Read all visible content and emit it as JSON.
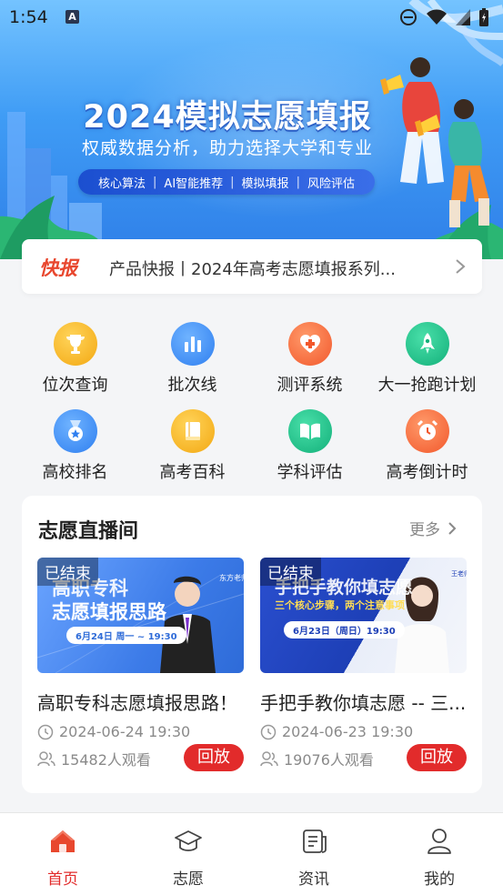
{
  "status_bar": {
    "time": "1:54",
    "notification_letter": "A"
  },
  "banner": {
    "title": "2024模拟志愿填报",
    "subtitle": "权威数据分析，助力选择大学和专业",
    "tags": [
      "核心算法",
      "AI智能推荐",
      "模拟填报",
      "风险评估"
    ]
  },
  "news": {
    "tag": "快报",
    "text": "产品快报丨2024年高考志愿填报系列..."
  },
  "grid": [
    {
      "label": "位次查询",
      "icon": "trophy-icon",
      "color": "#f6b61b"
    },
    {
      "label": "批次线",
      "icon": "bar-chart-icon",
      "color": "#3c8df3"
    },
    {
      "label": "测评系统",
      "icon": "heart-plus-icon",
      "color": "#f36b3b"
    },
    {
      "label": "大一抢跑计划",
      "icon": "rocket-icon",
      "color": "#1ec08a"
    },
    {
      "label": "高校排名",
      "icon": "medal-icon",
      "color": "#3c8df3"
    },
    {
      "label": "高考百科",
      "icon": "book-icon",
      "color": "#f6b61b"
    },
    {
      "label": "学科评估",
      "icon": "open-book-icon",
      "color": "#1ec08a"
    },
    {
      "label": "高考倒计时",
      "icon": "alarm-clock-icon",
      "color": "#f36b3b"
    }
  ],
  "live": {
    "title": "志愿直播间",
    "more": "更多",
    "items": [
      {
        "status": "已结束",
        "thumb_line1": "高职专科",
        "thumb_line2": "志愿填报思路",
        "thumb_date": "6月24日  周一 ~ 19:30",
        "title": "高职专科志愿填报思路！",
        "time": "2024-06-24 19:30",
        "viewers": "15482人观看",
        "action": "回放"
      },
      {
        "status": "已结束",
        "thumb_line1": "手把手教你填志愿",
        "thumb_line2": "三个核心步骤，两个注意事项",
        "thumb_date": "6月23日（周日）19:30",
        "title": "手把手教你填志愿 -- 三...",
        "time": "2024-06-23 19:30",
        "viewers": "19076人观看",
        "action": "回放"
      }
    ]
  },
  "nav": [
    {
      "label": "首页",
      "icon": "home-icon",
      "active": true
    },
    {
      "label": "志愿",
      "icon": "graduation-cap-icon",
      "active": false
    },
    {
      "label": "资讯",
      "icon": "news-icon",
      "active": false
    },
    {
      "label": "我的",
      "icon": "profile-icon",
      "active": false
    }
  ],
  "colors": {
    "accent": "#e22b2b",
    "tag_red": "#e8472e",
    "banner_blue": "#3f9cf5"
  }
}
